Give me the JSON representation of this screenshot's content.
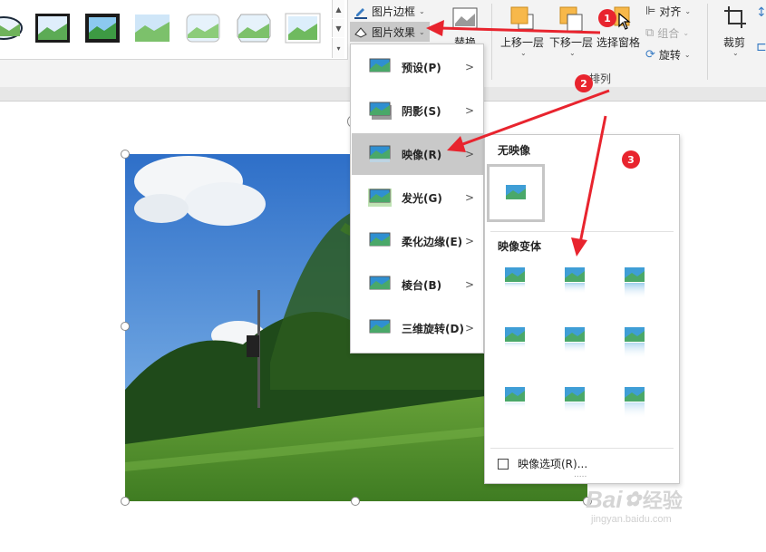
{
  "ribbon": {
    "picture_border_label": "图片边框",
    "picture_effects_label": "图片效果",
    "replace_label": "替换",
    "bring_forward_label": "上移一层",
    "send_backward_label": "下移一层",
    "selection_pane_label": "选择窗格",
    "align_label": "对齐",
    "group_label": "组合",
    "rotate_label": "旋转",
    "arrange_group_label": "排列",
    "crop_label": "裁剪"
  },
  "effects_menu": {
    "items": [
      {
        "label": "预设(P)",
        "icon": "preset-effect-icon"
      },
      {
        "label": "阴影(S)",
        "icon": "shadow-effect-icon"
      },
      {
        "label": "映像(R)",
        "icon": "reflection-effect-icon",
        "active": true
      },
      {
        "label": "发光(G)",
        "icon": "glow-effect-icon"
      },
      {
        "label": "柔化边缘(E)",
        "icon": "soft-edges-effect-icon"
      },
      {
        "label": "棱台(B)",
        "icon": "bevel-effect-icon"
      },
      {
        "label": "三维旋转(D)",
        "icon": "3d-rotation-effect-icon"
      }
    ]
  },
  "reflection_panel": {
    "no_reflection_title": "无映像",
    "variations_title": "映像变体",
    "options_label": "映像选项(R)...",
    "more_dots": "....."
  },
  "annotations": {
    "badges": [
      "1",
      "2",
      "3"
    ],
    "color": "#e8242e"
  },
  "watermark": {
    "brand": "Bai",
    "brand_suffix": "经验",
    "url": "jingyan.baidu.com"
  },
  "colors": {
    "ribbon_bg": "#f3f3f3",
    "menu_active": "#c9c9c9",
    "annotation_red": "#e8242e",
    "arrange_icon_orange": "#f7b84a"
  }
}
